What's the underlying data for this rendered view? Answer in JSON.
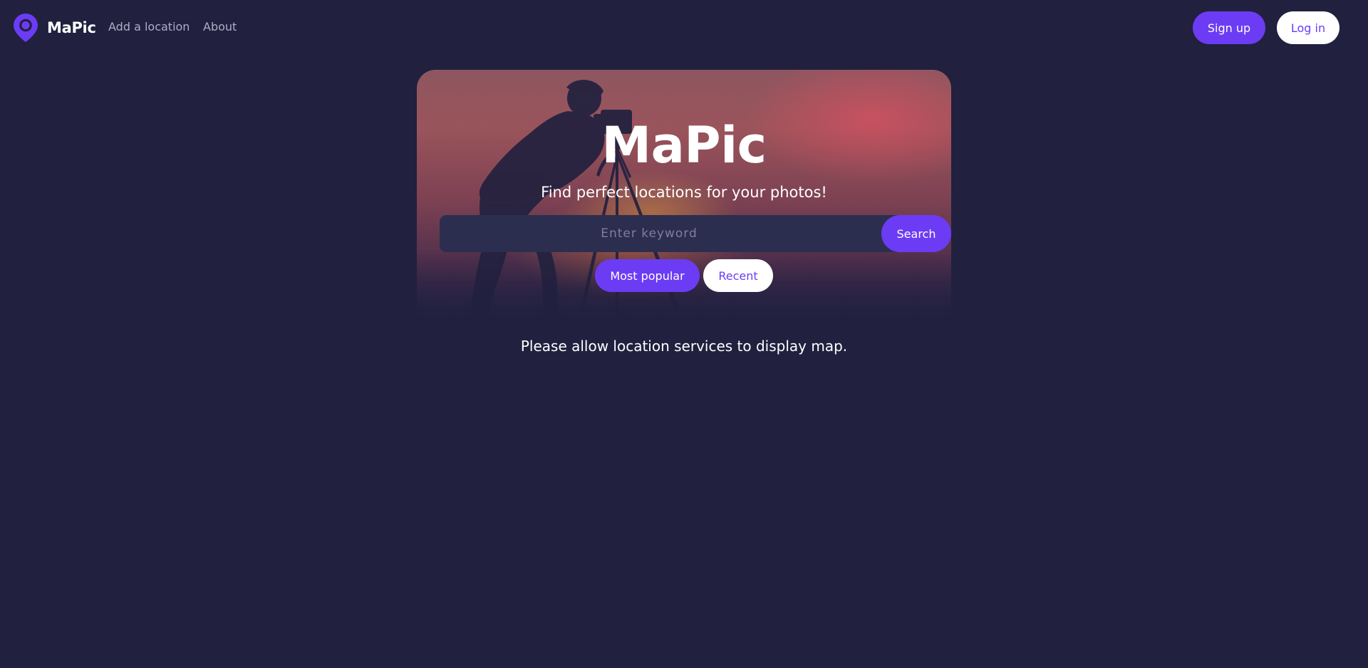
{
  "header": {
    "brand_name": "MaPic",
    "nav": {
      "add_location": "Add a location",
      "about": "About"
    },
    "signup_label": "Sign up",
    "login_label": "Log in",
    "logo_icon": "map-pin-icon"
  },
  "hero": {
    "title": "MaPic",
    "tagline": "Find perfect locations for your photos!",
    "search": {
      "placeholder": "Enter keyword",
      "value": "",
      "button_label": "Search"
    },
    "filters": {
      "most_popular": "Most popular",
      "recent": "Recent",
      "active": "most_popular"
    },
    "background_image": "photographer-silhouette-at-sunset"
  },
  "notice": "Please allow location services to display map.",
  "colors": {
    "background": "#21203f",
    "accent": "#6c3cf4",
    "nav_text": "#aeaec4",
    "input_bg": "#2c2e4f"
  }
}
